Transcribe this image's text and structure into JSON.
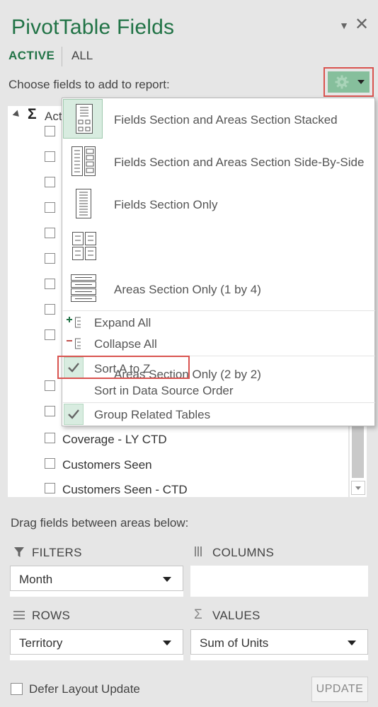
{
  "header": {
    "title": "PivotTable Fields",
    "tabs": [
      {
        "label": "ACTIVE",
        "selected": true
      },
      {
        "label": "ALL",
        "selected": false
      }
    ],
    "choose_label": "Choose fields to add to report:"
  },
  "field_list": {
    "root_label": "Active",
    "fields": [
      {
        "label": "",
        "checked": false
      },
      {
        "label": "",
        "checked": false
      },
      {
        "label": "",
        "checked": false
      },
      {
        "label": "",
        "checked": false
      },
      {
        "label": "",
        "checked": false
      },
      {
        "label": "",
        "checked": false
      },
      {
        "label": "",
        "checked": false
      },
      {
        "label": "",
        "checked": false
      },
      {
        "label": "",
        "checked": false
      },
      {
        "label": "",
        "checked": false
      },
      {
        "label": "",
        "checked": false
      },
      {
        "label": "Coverage - LY CTD",
        "checked": false
      },
      {
        "label": "Customers Seen",
        "checked": false
      },
      {
        "label": "Customers Seen - CTD",
        "checked": false
      }
    ]
  },
  "menu": {
    "layouts": [
      {
        "label": "Fields Section and Areas Section Stacked",
        "icon": "layout-stacked-icon",
        "selected": true
      },
      {
        "label": "Fields Section and Areas Section Side-By-Side",
        "icon": "layout-side-by-side-icon",
        "selected": false
      },
      {
        "label": "Fields Section Only",
        "icon": "layout-fields-only-icon",
        "selected": false
      },
      {
        "label": "Areas Section Only (2 by 2)",
        "icon": "layout-areas-2x2-icon",
        "selected": false
      },
      {
        "label": "Areas Section Only (1 by 4)",
        "icon": "layout-areas-1x4-icon",
        "selected": false
      }
    ],
    "expand_all": "Expand All",
    "collapse_all": "Collapse All",
    "sort_az": "Sort A to Z",
    "sort_source": "Sort in Data Source Order",
    "group_related": "Group Related Tables",
    "sort_az_checked": true,
    "group_related_checked": true
  },
  "areas": {
    "drag_label": "Drag fields between areas below:",
    "filters": {
      "title": "FILTERS",
      "items": [
        "Month"
      ]
    },
    "columns": {
      "title": "COLUMNS",
      "items": []
    },
    "rows": {
      "title": "ROWS",
      "items": [
        "Territory"
      ]
    },
    "values": {
      "title": "VALUES",
      "items": [
        "Sum of Units"
      ]
    }
  },
  "footer": {
    "defer_label": "Defer Layout Update",
    "defer_checked": false,
    "update_label": "UPDATE"
  },
  "colors": {
    "accent": "#217346",
    "gear_button_bg": "#86bf9c",
    "highlight_border": "#d9534f",
    "selected_bg": "#d8ece0"
  }
}
